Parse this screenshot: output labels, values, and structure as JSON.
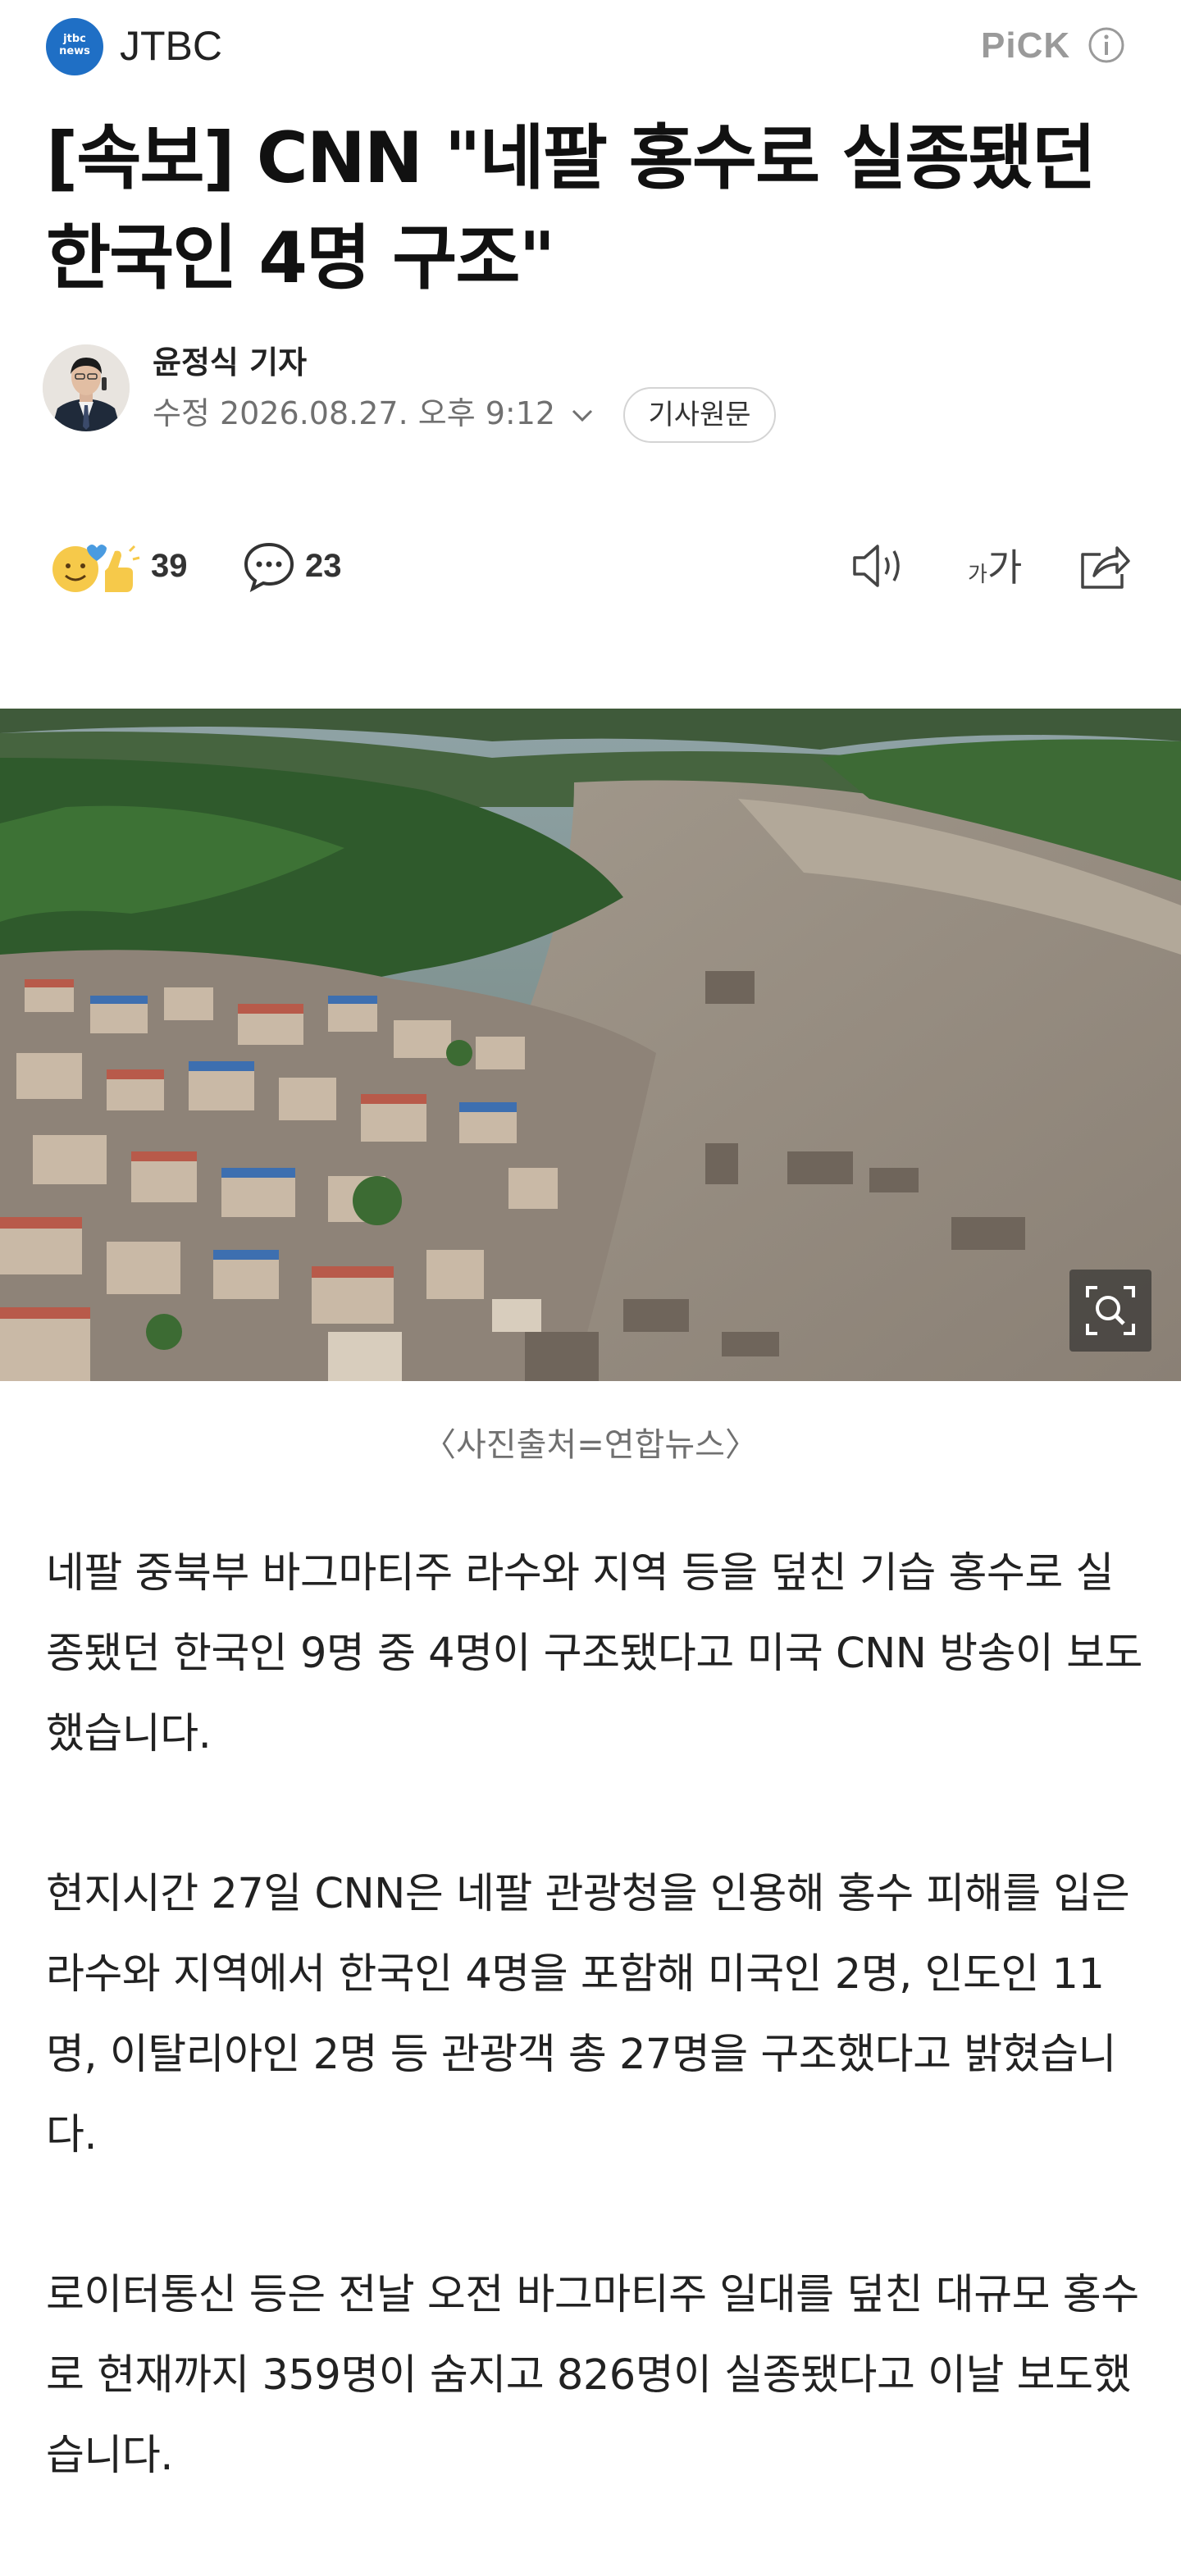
{
  "header": {
    "logo_text": "jtbc news",
    "brand": "JTBC",
    "pick_label": "PiCK"
  },
  "article": {
    "headline": "[속보] CNN \"네팔 홍수로 실종됐던 한국인 4명 구조\"",
    "reporter": "윤정식 기자",
    "modified": "수정 2026.08.27. 오후 9:12",
    "origin_button": "기사원문"
  },
  "actions": {
    "reaction_count": "39",
    "comment_count": "23",
    "font_small": "가",
    "font_big": "가"
  },
  "photo": {
    "caption": "〈사진출처=연합뉴스〉"
  },
  "body": {
    "paragraphs": [
      "네팔 중북부 바그마티주 라수와 지역 등을 덮친 기습 홍수로 실종됐던 한국인 9명 중 4명이 구조됐다고 미국 CNN 방송이 보도했습니다.",
      "현지시간 27일 CNN은 네팔 관광청을 인용해 홍수 피해를 입은라수와 지역에서 한국인 4명을 포함해 미국인 2명, 인도인 11명, 이탈리아인 2명 등 관광객 총 27명을 구조했다고 밝혔습니다.",
      "로이터통신 등은 전날 오전 바그마티주 일대를 덮친 대규모 홍수로 현재까지 359명이 숨지고 826명이 실종됐다고 이날 보도했습니다."
    ]
  },
  "colors": {
    "logo_blue": "#1f6fc5",
    "pick_gray": "#9a9a9a",
    "meta_gray": "#707070"
  }
}
